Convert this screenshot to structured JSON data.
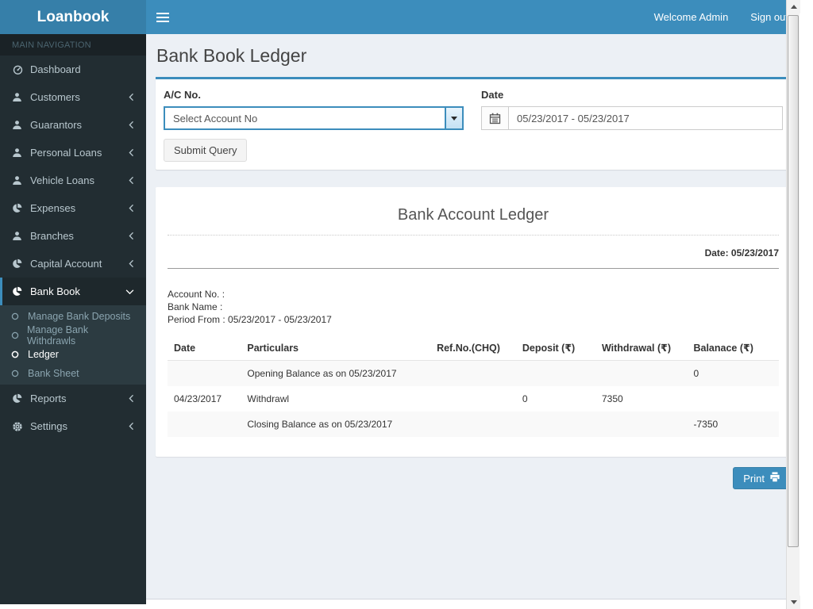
{
  "colors": {
    "navbar": "#3c8dbc",
    "logo_bg": "#367fa9",
    "sidebar_bg": "#222d32",
    "submenu_bg": "#2c3b41",
    "content_bg": "#ecf0f5",
    "accent": "#3c8dbc",
    "stripe": "#f9f9f9"
  },
  "header": {
    "logo": "Loanbook",
    "welcome": "Welcome Admin",
    "sign_out": "Sign out"
  },
  "sidebar": {
    "section": "MAIN NAVIGATION",
    "items": [
      {
        "label": "Dashboard",
        "icon": "gauge-icon"
      },
      {
        "label": "Customers",
        "icon": "user-icon"
      },
      {
        "label": "Guarantors",
        "icon": "user-icon"
      },
      {
        "label": "Personal Loans",
        "icon": "user-icon"
      },
      {
        "label": "Vehicle Loans",
        "icon": "user-icon"
      },
      {
        "label": "Expenses",
        "icon": "pie-chart-icon"
      },
      {
        "label": "Branches",
        "icon": "user-icon"
      },
      {
        "label": "Capital Account",
        "icon": "pie-chart-icon"
      },
      {
        "label": "Bank Book",
        "icon": "pie-chart-icon"
      },
      {
        "label": "Reports",
        "icon": "pie-chart-icon"
      },
      {
        "label": "Settings",
        "icon": "gear-icon"
      }
    ],
    "bank_book_children": [
      {
        "label": "Manage Bank Deposits"
      },
      {
        "label": "Manage Bank Withdrawls"
      },
      {
        "label": "Ledger"
      },
      {
        "label": "Bank Sheet"
      }
    ]
  },
  "page": {
    "title": "Bank Book Ledger"
  },
  "filter": {
    "account_label": "A/C No.",
    "account_value": "Select Account No",
    "date_label": "Date",
    "date_value": "05/23/2017 - 05/23/2017",
    "submit_label": "Submit Query"
  },
  "report": {
    "title": "Bank Account Ledger",
    "date_line": "Date: 05/23/2017",
    "account_no_line": "Account No. :",
    "bank_name_line": "Bank Name :",
    "period_line": "Period From : 05/23/2017 - 05/23/2017",
    "table": {
      "headers": [
        "Date",
        "Particulars",
        "Ref.No.(CHQ)",
        "Deposit (₹)",
        "Withdrawal (₹)",
        "Balanace (₹)"
      ],
      "rows": [
        [
          "",
          "Opening Balance as on 05/23/2017",
          "",
          "",
          "",
          "0"
        ],
        [
          "04/23/2017",
          "Withdrawl",
          "",
          "0",
          "7350",
          ""
        ],
        [
          "",
          "Closing Balance as on 05/23/2017",
          "",
          "",
          "",
          "-7350"
        ]
      ]
    },
    "print_label": "Print"
  }
}
